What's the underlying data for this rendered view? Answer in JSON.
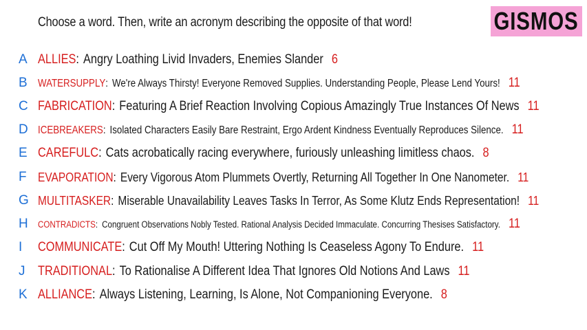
{
  "header": {
    "instruction": "Choose a word. Then, write an acronym describing the opposite of that word!",
    "logo": "GISMOS"
  },
  "colors": {
    "letter": "#1d6fd6",
    "word": "#d61e1e",
    "text": "#1a1a1a",
    "logo_bg": "#f5a3d6"
  },
  "entries": [
    {
      "letter": "A",
      "word": "ALLIES",
      "acronym": "Angry Loathing Livid Invaders, Enemies Slander",
      "count": "6"
    },
    {
      "letter": "B",
      "word": "WATERSUPPLY",
      "acronym": "We're Always Thirsty! Everyone Removed Supplies. Understanding People, Please Lend Yours!",
      "count": "11"
    },
    {
      "letter": "C",
      "word": "FABRICATION",
      "acronym": "Featuring A Brief Reaction Involving Copious Amazingly True Instances Of News",
      "count": "11"
    },
    {
      "letter": "D",
      "word": "ICEBREAKERS",
      "acronym": "Isolated Characters Easily Bare Restraint, Ergo Ardent Kindness Eventually Reproduces Silence.",
      "count": "11"
    },
    {
      "letter": "E",
      "word": "CAREFULC",
      "acronym": "Cats acrobatically racing everywhere, furiously unleashing limitless chaos.",
      "count": "8"
    },
    {
      "letter": "F",
      "word": "EVAPORATION",
      "acronym": "Every Vigorous Atom Plummets Overtly, Returning All Together In One Nanometer.",
      "count": "11"
    },
    {
      "letter": "G",
      "word": "MULTITASKER",
      "acronym": "Miserable Unavailability Leaves Tasks In Terror, As Some Klutz Ends Representation!",
      "count": "11"
    },
    {
      "letter": "H",
      "word": "CONTRADICTS",
      "acronym": "Congruent Observations Nobly Tested. Rational Analysis Decided Immaculate. Concurring Thesises Satisfactory.",
      "count": "11"
    },
    {
      "letter": "I",
      "word": "COMMUNICATE",
      "acronym": "Cut Off My Mouth! Uttering Nothing Is Ceaseless Agony To Endure.",
      "count": "11"
    },
    {
      "letter": "J",
      "word": "TRADITIONAL",
      "acronym": "To Rationalise A Different Idea That Ignores Old Notions And Laws",
      "count": "11"
    },
    {
      "letter": "K",
      "word": "ALLIANCE",
      "acronym": "Always Listening, Learning, Is Alone, Not Companioning Everyone.",
      "count": "8"
    }
  ]
}
